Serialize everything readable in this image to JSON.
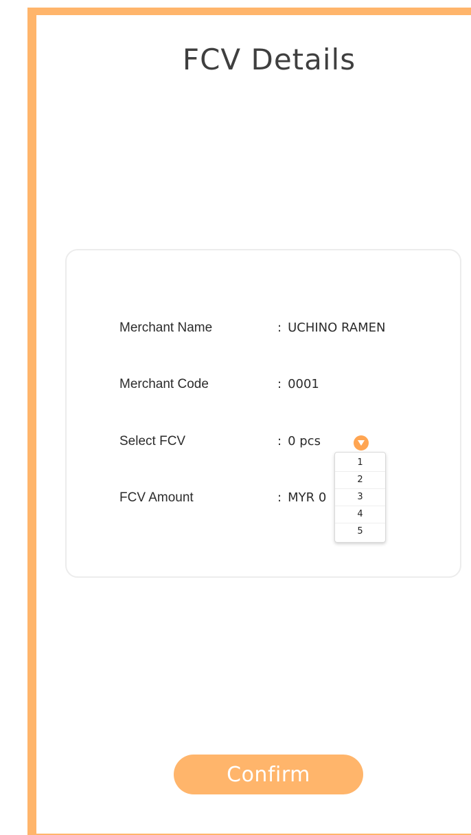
{
  "page": {
    "title": "FCV Details",
    "accent_color": "#ffb56b"
  },
  "details": {
    "merchant_name": {
      "label": "Merchant Name",
      "colon": ":",
      "value": "UCHINO RAMEN"
    },
    "merchant_code": {
      "label": "Merchant Code",
      "colon": ":",
      "value": "0001"
    },
    "select_fcv": {
      "label": "Select FCV",
      "colon": ":",
      "value": "0 pcs",
      "icon": "chevron-down-icon"
    },
    "fcv_amount": {
      "label": "FCV Amount",
      "colon": ":",
      "value": "MYR 0"
    }
  },
  "dropdown": {
    "options": [
      "1",
      "2",
      "3",
      "4",
      "5"
    ]
  },
  "confirm_label": "Confirm"
}
